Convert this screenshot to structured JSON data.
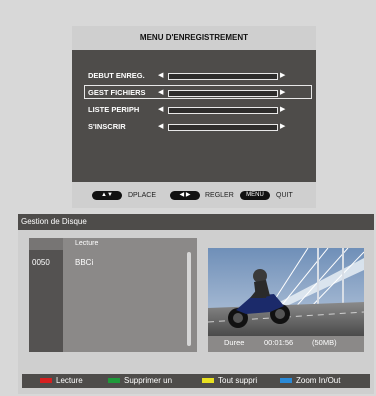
{
  "menu": {
    "title": "MENU D'ENREGISTREMENT",
    "items": [
      {
        "label": "DEBUT ENREG."
      },
      {
        "label": "GEST FICHIERS"
      },
      {
        "label": "LISTE PERIPH"
      },
      {
        "label": "S'INSCRIR"
      }
    ],
    "selected_index": 1,
    "footer": {
      "nav_label": "DPLACE",
      "adjust_label": "REGLER",
      "menu_key": "MENU",
      "quit_label": "QUIT"
    }
  },
  "disk": {
    "title": "Gestion de Disque",
    "list_header": "Lecture",
    "rows": [
      {
        "number": "0050",
        "name": "BBCi"
      }
    ],
    "preview": {
      "duration_label": "Duree",
      "duration_value": "00:01:56",
      "size": "(50MB)"
    },
    "legend": [
      {
        "label": "Lecture",
        "color": "#d62020"
      },
      {
        "label": "Supprimer un",
        "color": "#1e9a3a"
      },
      {
        "label": "Tout suppri",
        "color": "#e8e020"
      },
      {
        "label": "Zoom In/Out",
        "color": "#2a8ad8"
      }
    ]
  }
}
